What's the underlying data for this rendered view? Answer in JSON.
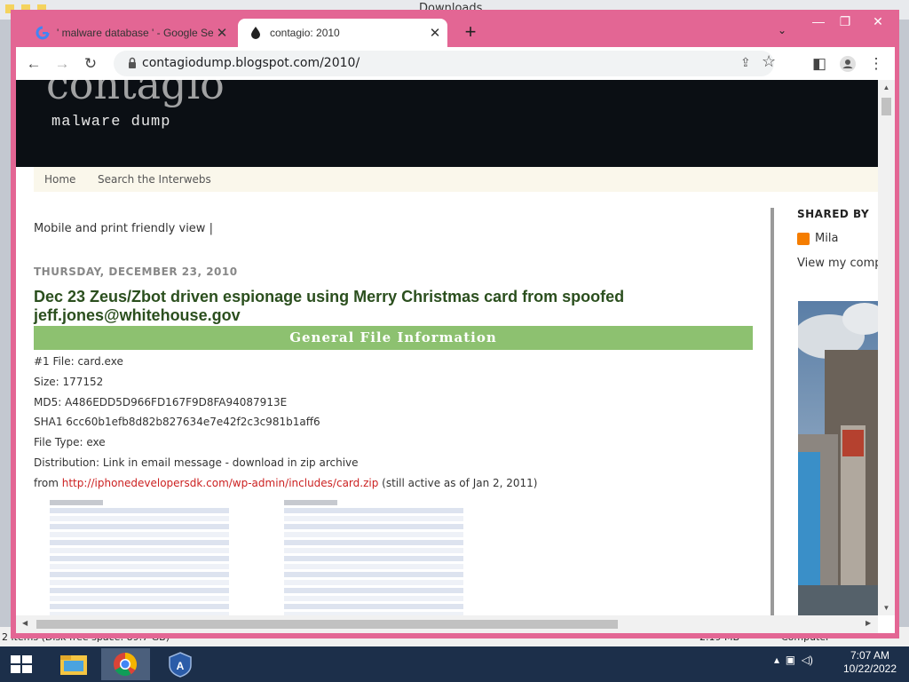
{
  "desktop": {
    "window_title": "Downloads",
    "status_items": "2 items (Disk free space: 89.7 GB)",
    "status_size": "2.19 MB",
    "status_location": "Computer"
  },
  "browser": {
    "tabs": [
      {
        "title": "' malware database ' - Google Se",
        "icon": "google-g-icon",
        "active": false
      },
      {
        "title": "contagio: 2010",
        "icon": "contagio-icon",
        "active": true
      }
    ],
    "new_tab": "+",
    "url": "contagiodump.blogspot.com/2010/"
  },
  "blog": {
    "logo_text": "contagio",
    "description": "malware dump",
    "nav": [
      "Home",
      "Search the Interwebs"
    ],
    "mobile_link": "Mobile and print friendly view |",
    "date": "THURSDAY, DECEMBER 23, 2010",
    "title": "Dec 23 Zeus/Zbot driven espionage using Merry Christmas card from spoofed jeff.jones@whitehouse.gov",
    "section_header": "General File Information",
    "file_lines": [
      "#1 File: card.exe",
      "Size: 177152",
      "MD5:  A486EDD5D966FD167F9D8FA94087913E",
      "SHA1 6cc60b1efb8d82b827634e7e42f2c3c981b1aff6",
      "File Type:  exe",
      "Distribution: Link in email message - download in zip archive"
    ],
    "from_prefix": "from ",
    "from_link": "http://iphonedevelopersdk.com/wp-admin/includes/card.zip",
    "from_suffix": " (still active as of Jan 2, 2011)"
  },
  "sidebar": {
    "shared_by": "SHARED BY",
    "author": "Mila",
    "view_profile": "View my comp"
  },
  "taskbar": {
    "time": "7:07 AM",
    "date": "10/22/2022",
    "apps": [
      "windows-start-icon",
      "file-explorer-icon",
      "chrome-icon",
      "defender-icon"
    ]
  },
  "colors": {
    "chrome_frame": "#e36694",
    "header_bg": "#0b0f14",
    "section_green": "#8dc170",
    "post_title": "#2b4f1e",
    "link_red": "#cc2222",
    "taskbar": "#1c2f4a"
  }
}
